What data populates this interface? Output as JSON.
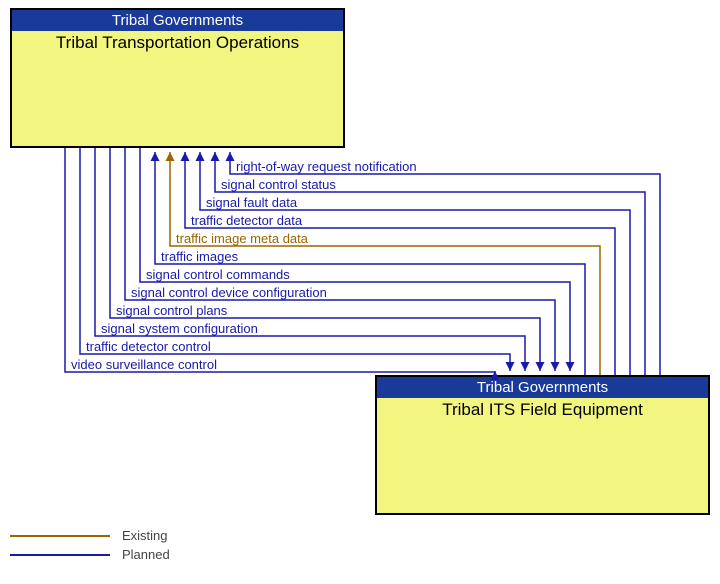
{
  "top_node": {
    "header": "Tribal Governments",
    "title": "Tribal Transportation Operations"
  },
  "bottom_node": {
    "header": "Tribal Governments",
    "title": "Tribal ITS Field Equipment"
  },
  "flows_to_top": [
    {
      "label": "right-of-way request notification",
      "status": "planned"
    },
    {
      "label": "signal control status",
      "status": "planned"
    },
    {
      "label": "signal fault data",
      "status": "planned"
    },
    {
      "label": "traffic detector data",
      "status": "planned"
    },
    {
      "label": "traffic image meta data",
      "status": "existing"
    },
    {
      "label": "traffic images",
      "status": "planned"
    }
  ],
  "flows_to_bottom": [
    {
      "label": "signal control commands",
      "status": "planned"
    },
    {
      "label": "signal control device configuration",
      "status": "planned"
    },
    {
      "label": "signal control plans",
      "status": "planned"
    },
    {
      "label": "signal system configuration",
      "status": "planned"
    },
    {
      "label": "traffic detector control",
      "status": "planned"
    },
    {
      "label": "video surveillance control",
      "status": "planned"
    }
  ],
  "legend": {
    "existing": "Existing",
    "planned": "Planned"
  },
  "colors": {
    "planned": "#1a1aaa",
    "existing": "#9c6500"
  }
}
